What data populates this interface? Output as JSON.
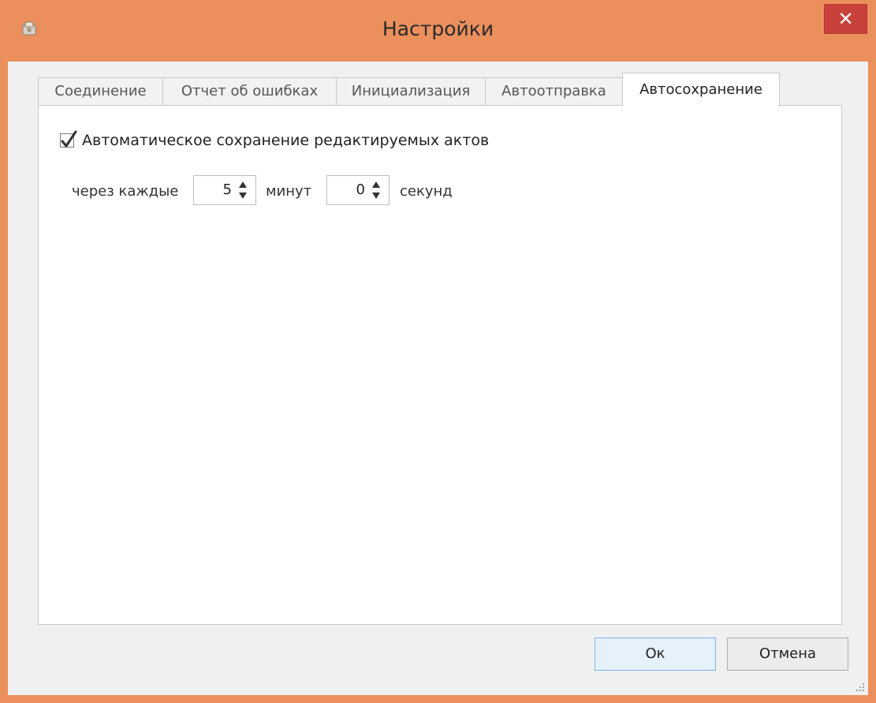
{
  "window": {
    "title": "Настройки",
    "close_glyph": "✕"
  },
  "tabs": [
    {
      "label": "Соединение",
      "active": false
    },
    {
      "label": "Отчет об ошибках",
      "active": false
    },
    {
      "label": "Инициализация",
      "active": false
    },
    {
      "label": "Автоотправка",
      "active": false
    },
    {
      "label": "Автосохранение",
      "active": true
    }
  ],
  "autosave": {
    "checkbox_label": "Автоматическое сохранение редактируемых актов",
    "checked": true,
    "every_label": "через каждые",
    "minutes_value": "5",
    "minutes_label": "минут",
    "seconds_value": "0",
    "seconds_label": "секунд"
  },
  "buttons": {
    "ok_label": "Ок",
    "cancel_label": "Отмена"
  },
  "colors": {
    "window_frame": "#eb8f5c",
    "close_button": "#c8413a",
    "default_button_border": "#7eb4ea"
  },
  "icons": {
    "app": "app-icon",
    "close": "close-icon",
    "check": "checkmark-icon",
    "spin": "spin-arrows-icon",
    "grip": "resize-grip-icon"
  }
}
